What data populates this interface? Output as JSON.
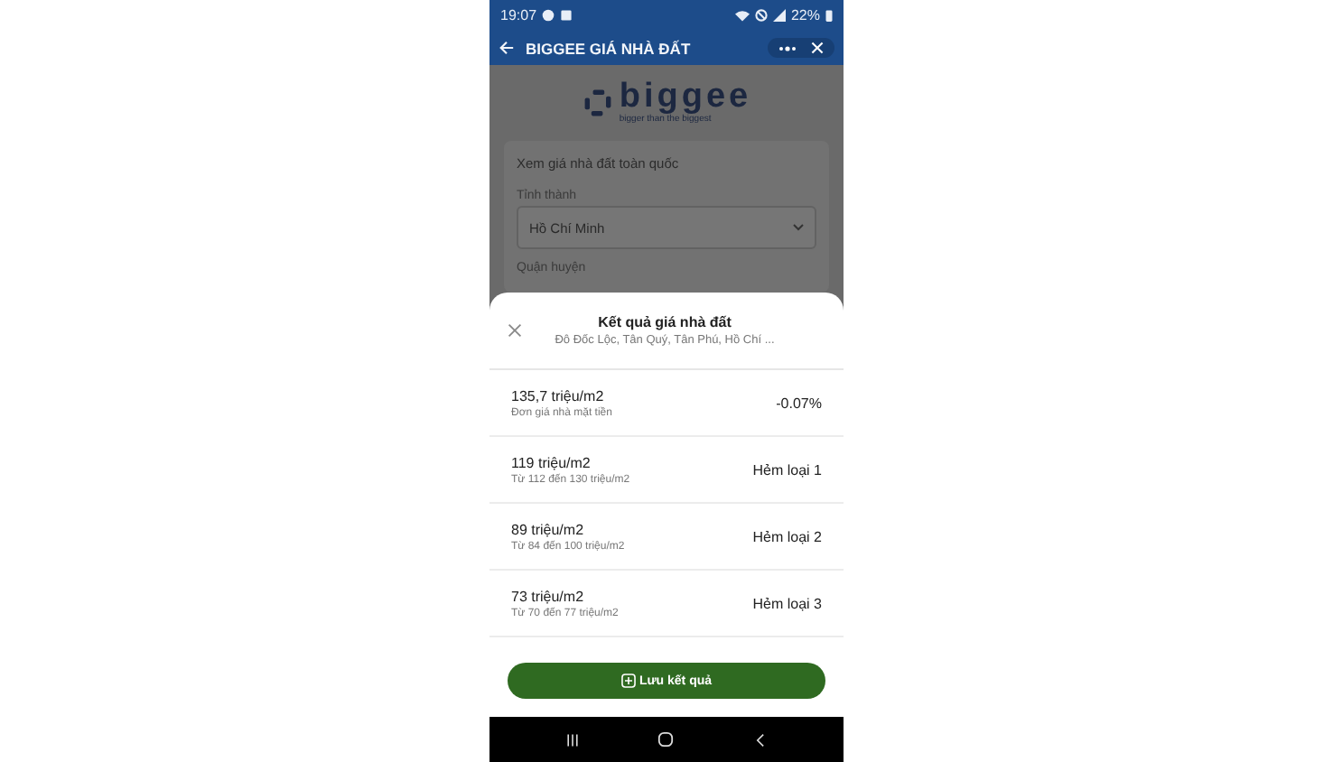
{
  "status_bar": {
    "time": "19:07",
    "battery": "22%"
  },
  "app_bar": {
    "title": "BIGGEE GIÁ NHÀ ĐẤT"
  },
  "logo": {
    "name": "biggee",
    "tagline": "bigger than the biggest"
  },
  "form": {
    "heading": "Xem giá nhà đất toàn quốc",
    "fields": [
      {
        "label": "Tỉnh thành",
        "value": "Hồ Chí Minh"
      }
    ],
    "next_label": "Quận huyện"
  },
  "result_sheet": {
    "title": "Kết quả giá nhà đất",
    "subtitle": "Đô Đốc Lộc, Tân Quý, Tân Phú, Hồ Chí ...",
    "rows": [
      {
        "price": "135,7 triệu/m2",
        "note": "Đơn giá nhà mặt tiền",
        "tag": "-0.07%"
      },
      {
        "price": "119 triệu/m2",
        "note": "Từ 112 đến 130 triệu/m2",
        "tag": "Hẻm loại 1"
      },
      {
        "price": "89 triệu/m2",
        "note": "Từ 84 đến 100 triệu/m2",
        "tag": "Hẻm loại 2"
      },
      {
        "price": "73 triệu/m2",
        "note": "Từ 70 đến 77 triệu/m2",
        "tag": "Hẻm loại 3"
      }
    ],
    "save_button": "Lưu kết quả"
  }
}
